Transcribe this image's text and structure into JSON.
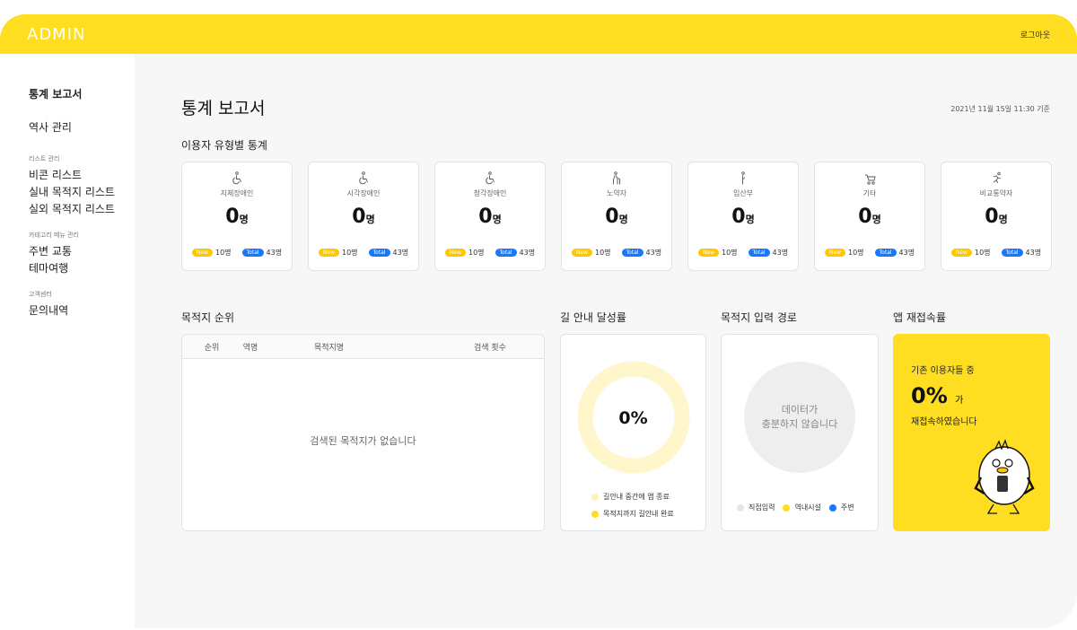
{
  "header": {
    "logo": "ADMIN",
    "logout": "로그아웃"
  },
  "sidebar": {
    "items_top": [
      "통계 보고서",
      "역사 관리"
    ],
    "group1": {
      "label": "리스트 관리",
      "items": [
        "비콘 리스트",
        "실내 목적지 리스트",
        "실외 목적지 리스트"
      ]
    },
    "group2": {
      "label": "카테고리 메뉴 관리",
      "items": [
        "주변 교통",
        "테마여행"
      ]
    },
    "group3": {
      "label": "고객센터",
      "items": [
        "문의내역"
      ]
    }
  },
  "page": {
    "title": "통계 보고서",
    "timestamp": "2021년 11월 15일  11:30 기준"
  },
  "user_stats": {
    "title": "이용자 유형별 통계",
    "cards": [
      {
        "label": "지체장애인",
        "value": "0",
        "unit": "명",
        "new_label": "New",
        "new": "10명",
        "total_label": "Total",
        "total": "43명"
      },
      {
        "label": "시각장애인",
        "value": "0",
        "unit": "명",
        "new_label": "New",
        "new": "10명",
        "total_label": "Total",
        "total": "43명"
      },
      {
        "label": "청각장애인",
        "value": "0",
        "unit": "명",
        "new_label": "New",
        "new": "10명",
        "total_label": "Total",
        "total": "43명"
      },
      {
        "label": "노약자",
        "value": "0",
        "unit": "명",
        "new_label": "New",
        "new": "10명",
        "total_label": "Total",
        "total": "43명"
      },
      {
        "label": "임산부",
        "value": "0",
        "unit": "명",
        "new_label": "New",
        "new": "10명",
        "total_label": "Total",
        "total": "43명"
      },
      {
        "label": "기타",
        "value": "0",
        "unit": "명",
        "new_label": "New",
        "new": "10명",
        "total_label": "Total",
        "total": "43명"
      },
      {
        "label": "비교통약자",
        "value": "0",
        "unit": "명",
        "new_label": "New",
        "new": "10명",
        "total_label": "Total",
        "total": "43명"
      }
    ]
  },
  "ranking": {
    "title": "목적지 순위",
    "columns": [
      "순위",
      "역명",
      "목적지명",
      "검색 횟수"
    ],
    "empty": "검색된 목적지가 없습니다"
  },
  "guide_rate": {
    "title": "길 안내 달성률",
    "value": "0%",
    "legend": [
      "길안내 중간에 앱 종료",
      "목적지까지 길안내 완료"
    ],
    "colors": [
      "#FFF6CC",
      "#FFDD21"
    ]
  },
  "input_route": {
    "title": "목적지 입력 경로",
    "empty_line1": "데이터가",
    "empty_line2": "충분하지 않습니다",
    "legend": [
      "직접입력",
      "역내시설",
      "주변"
    ],
    "colors": [
      "#E6E6E6",
      "#FFDD21",
      "#1677FF"
    ]
  },
  "retention": {
    "title": "앱 재접속률",
    "line1": "기존 이용자들 중",
    "value": "0%",
    "suffix": "가",
    "line2": "재접속하였습니다"
  }
}
